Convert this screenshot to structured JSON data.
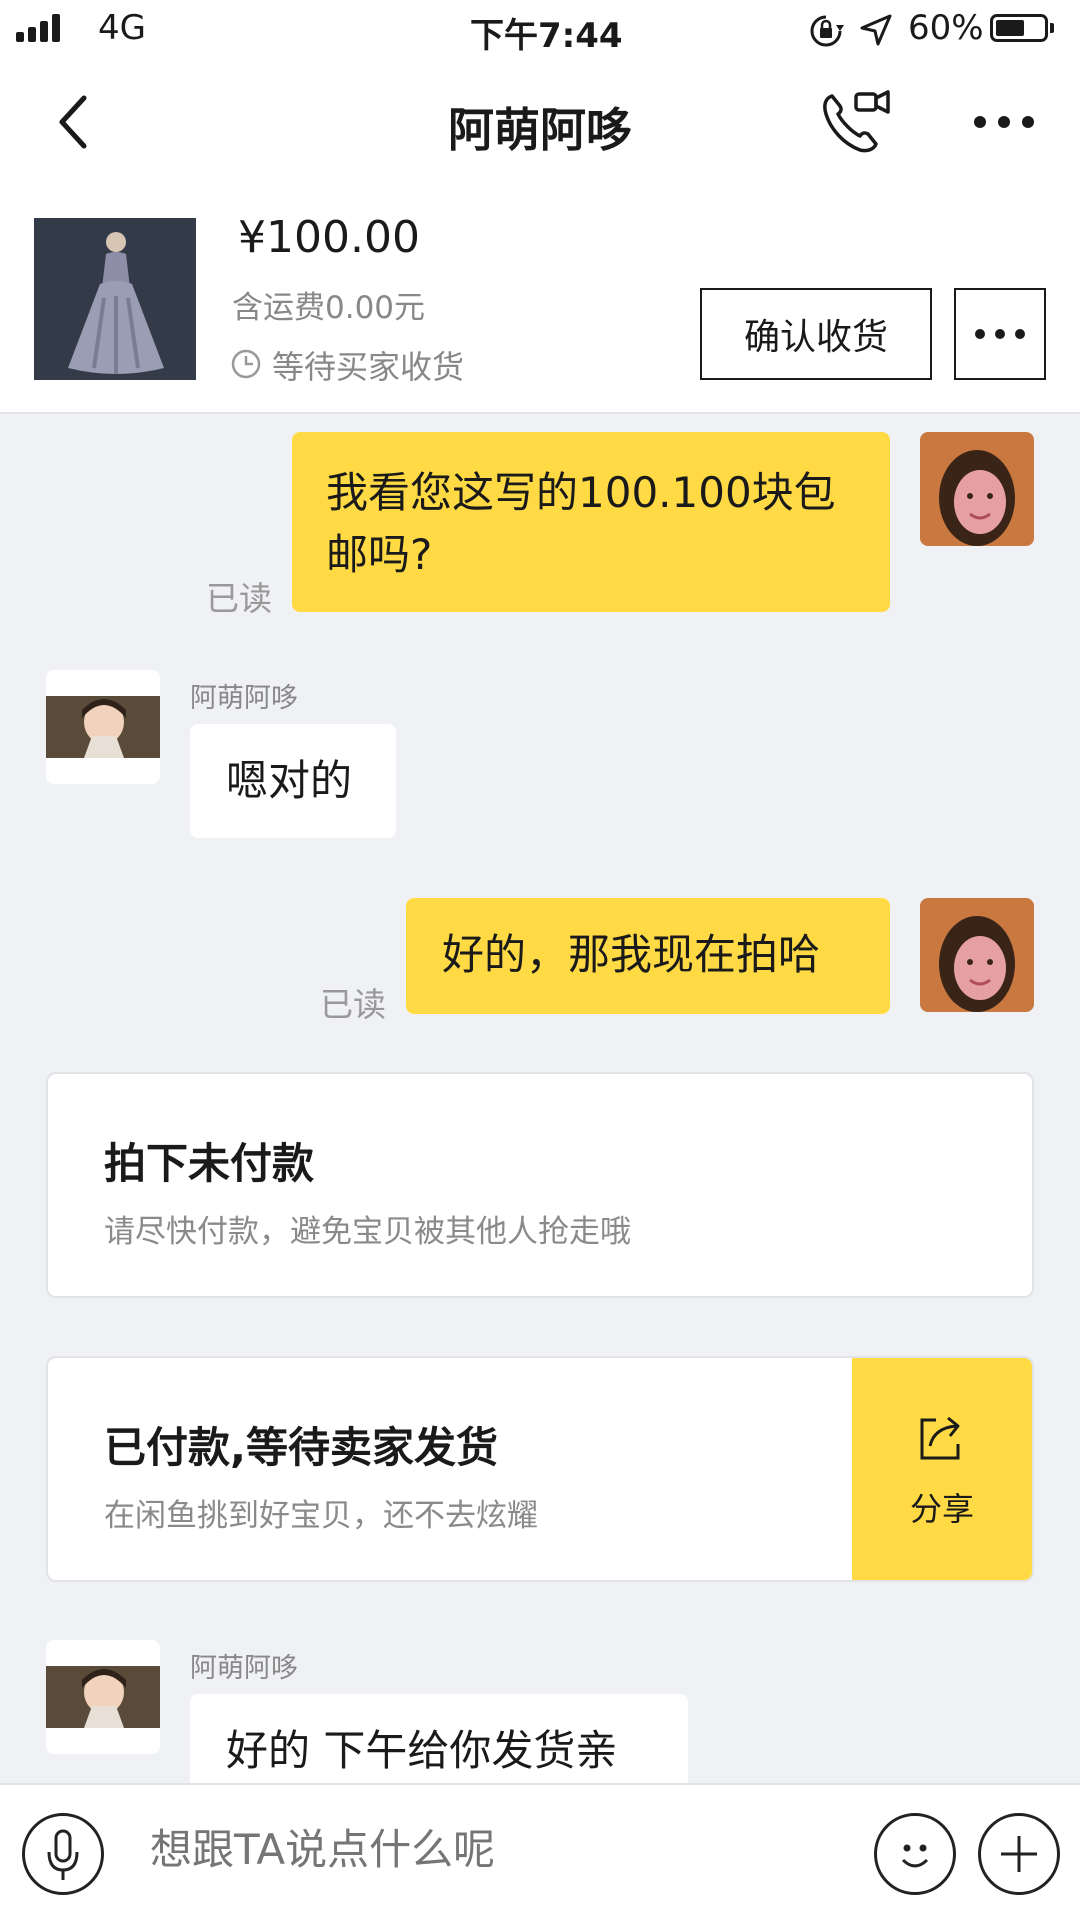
{
  "status_bar": {
    "carrier": "4G",
    "time": "下午7:44",
    "battery_percent": "60%",
    "battery_level": 0.6
  },
  "nav": {
    "title": "阿萌阿哆",
    "icons": [
      "back-arrow-icon",
      "video-call-icon",
      "more-icon"
    ]
  },
  "product": {
    "price": "¥100.00",
    "shipping": "含运费0.00元",
    "status": "等待买家收货",
    "confirm_button": "确认收货",
    "more_button_icon": "more-icon"
  },
  "messages": [
    {
      "side": "right",
      "text_line1": "我看您这写的100.100块包",
      "text_line2": "邮吗?",
      "read": "已读"
    },
    {
      "side": "left",
      "sender": "阿萌阿哆",
      "text": "嗯对的"
    },
    {
      "side": "right",
      "text": "好的，那我现在拍哈",
      "read": "已读"
    }
  ],
  "cards": [
    {
      "title": "拍下未付款",
      "subtitle": "请尽快付款，避免宝贝被其他人抢走哦"
    },
    {
      "title": "已付款,等待卖家发货",
      "subtitle": "在闲鱼挑到好宝贝，还不去炫耀",
      "action": "分享",
      "action_icon": "share-icon"
    }
  ],
  "last_message": {
    "side": "left",
    "sender": "阿萌阿哆",
    "text": "好的 下午给你发货亲"
  },
  "input_bar": {
    "placeholder": "想跟TA说点什么呢",
    "icons": [
      "microphone-icon",
      "emoji-icon",
      "plus-icon"
    ]
  },
  "colors": {
    "accent_yellow": "#ffda44",
    "background": "#f0f1f5"
  }
}
